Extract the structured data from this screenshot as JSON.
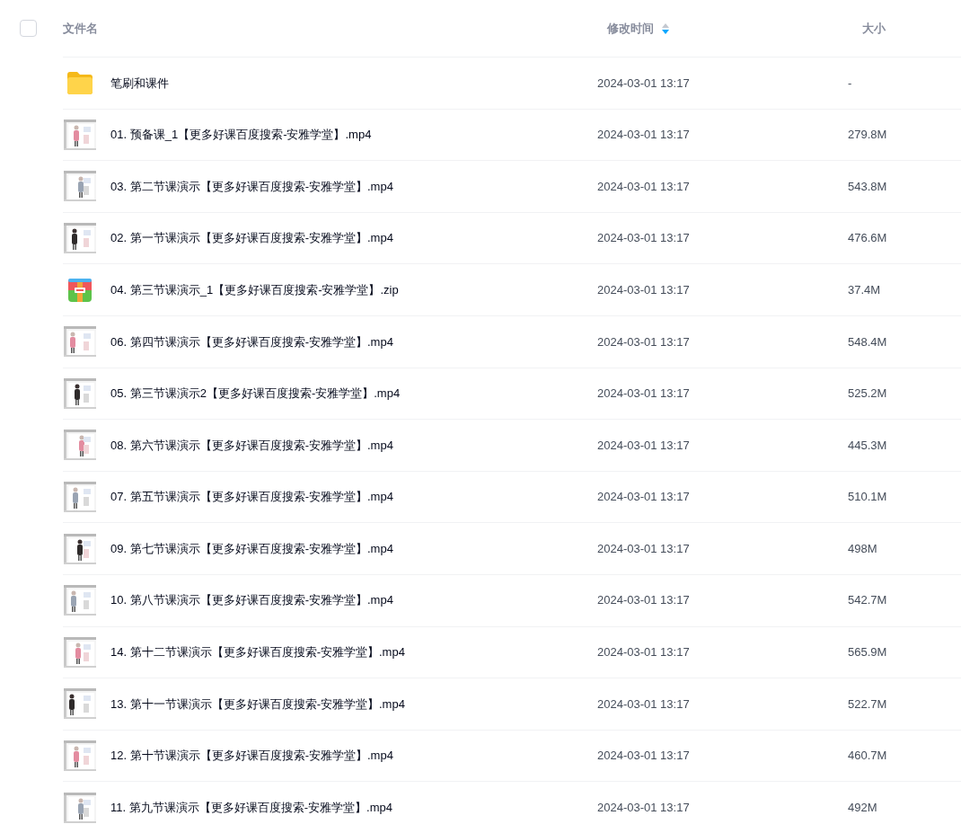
{
  "header": {
    "select_all": {
      "checked": false
    },
    "columns": [
      {
        "label": "文件名",
        "kind": "name"
      },
      {
        "label": "修改时间",
        "kind": "time",
        "sorted": true,
        "descending": true
      },
      {
        "label": "大小",
        "kind": "size"
      }
    ]
  },
  "files": [
    {
      "kind": "folder",
      "name": "笔刷和课件",
      "modified": "2024-03-01 13:17",
      "size": "-"
    },
    {
      "kind": "video",
      "name": "01. 预备课_1【更多好课百度搜索-安雅学堂】.mp4",
      "modified": "2024-03-01 13:17",
      "size": "279.8M"
    },
    {
      "kind": "video",
      "name": "03. 第二节课演示【更多好课百度搜索-安雅学堂】.mp4",
      "modified": "2024-03-01 13:17",
      "size": "543.8M"
    },
    {
      "kind": "video",
      "name": "02. 第一节课演示【更多好课百度搜索-安雅学堂】.mp4",
      "modified": "2024-03-01 13:17",
      "size": "476.6M"
    },
    {
      "kind": "zip",
      "name": "04. 第三节课演示_1【更多好课百度搜索-安雅学堂】.zip",
      "modified": "2024-03-01 13:17",
      "size": "37.4M"
    },
    {
      "kind": "video",
      "name": "06. 第四节课演示【更多好课百度搜索-安雅学堂】.mp4",
      "modified": "2024-03-01 13:17",
      "size": "548.4M"
    },
    {
      "kind": "video",
      "name": "05. 第三节课演示2【更多好课百度搜索-安雅学堂】.mp4",
      "modified": "2024-03-01 13:17",
      "size": "525.2M"
    },
    {
      "kind": "video",
      "name": "08. 第六节课演示【更多好课百度搜索-安雅学堂】.mp4",
      "modified": "2024-03-01 13:17",
      "size": "445.3M"
    },
    {
      "kind": "video",
      "name": "07. 第五节课演示【更多好课百度搜索-安雅学堂】.mp4",
      "modified": "2024-03-01 13:17",
      "size": "510.1M"
    },
    {
      "kind": "video",
      "name": "09. 第七节课演示【更多好课百度搜索-安雅学堂】.mp4",
      "modified": "2024-03-01 13:17",
      "size": "498M"
    },
    {
      "kind": "video",
      "name": "10. 第八节课演示【更多好课百度搜索-安雅学堂】.mp4",
      "modified": "2024-03-01 13:17",
      "size": "542.7M"
    },
    {
      "kind": "video",
      "name": "14. 第十二节课演示【更多好课百度搜索-安雅学堂】.mp4",
      "modified": "2024-03-01 13:17",
      "size": "565.9M"
    },
    {
      "kind": "video",
      "name": "13. 第十一节课演示【更多好课百度搜索-安雅学堂】.mp4",
      "modified": "2024-03-01 13:17",
      "size": "522.7M"
    },
    {
      "kind": "video",
      "name": "12. 第十节课演示【更多好课百度搜索-安雅学堂】.mp4",
      "modified": "2024-03-01 13:17",
      "size": "460.7M"
    },
    {
      "kind": "video",
      "name": "11. 第九节课演示【更多好课百度搜索-安雅学堂】.mp4",
      "modified": "2024-03-01 13:17",
      "size": "492M"
    }
  ]
}
